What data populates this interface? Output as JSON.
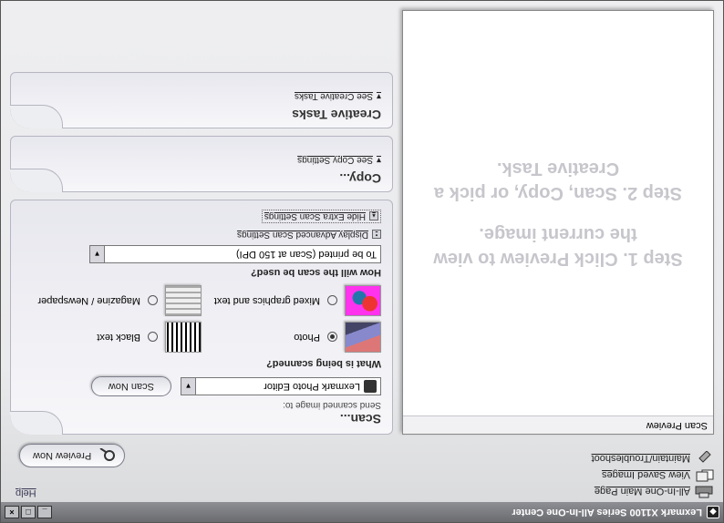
{
  "title": "Lexmark X1100 Series All-In-One Center",
  "help": "Help",
  "nav": {
    "main": "All-In-One Main Page",
    "saved": "View Saved Images",
    "maintain": "Maintain/Troubleshoot"
  },
  "previewNow": "Preview Now",
  "scanPreview": {
    "header": "Scan Preview",
    "msg_line1": "Step 1.  Click Preview to view the current image.",
    "msg_line2": "Step 2.  Scan, Copy, or pick a Creative Task."
  },
  "scan": {
    "title": "Scan...",
    "sendTo": "Send scanned image to:",
    "target": "Lexmark Photo Editor",
    "scanNow": "Scan Now",
    "whatQ": "What is being scanned?",
    "opts": {
      "photo": "Photo",
      "black": "Black text",
      "mixed": "Mixed graphics and text",
      "news": "Magazine / Newspaper"
    },
    "howQ": "How will the scan be used?",
    "howVal": "To be printed (Scan at 150 DPI)",
    "adv": "Display Advanced Scan Settings",
    "hide": "Hide Extra Scan Settings"
  },
  "copy": {
    "title": "Copy...",
    "link": "See Copy Settings"
  },
  "creative": {
    "title": "Creative Tasks",
    "link": "See Creative Tasks"
  }
}
